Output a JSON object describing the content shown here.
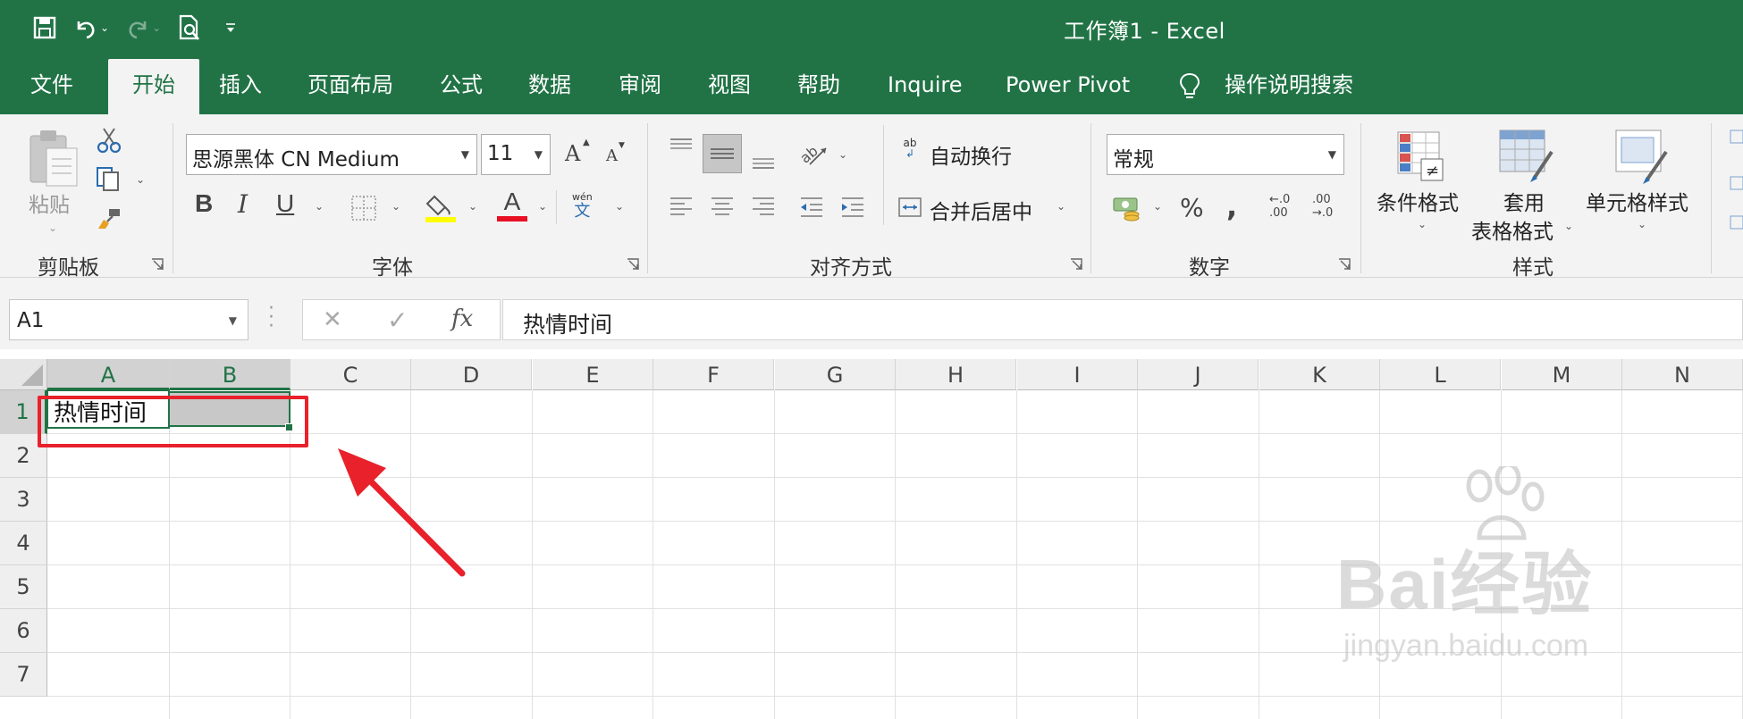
{
  "window": {
    "title": "工作簿1  -  Excel"
  },
  "qat": {
    "save_icon": "save-icon",
    "undo_icon": "undo-icon",
    "redo_icon": "redo-icon",
    "print_preview_icon": "print-preview-icon",
    "customize_icon": "customize-qat-icon"
  },
  "tabs": [
    {
      "label": "文件"
    },
    {
      "label": "开始"
    },
    {
      "label": "插入"
    },
    {
      "label": "页面布局"
    },
    {
      "label": "公式"
    },
    {
      "label": "数据"
    },
    {
      "label": "审阅"
    },
    {
      "label": "视图"
    },
    {
      "label": "帮助"
    },
    {
      "label": "Inquire"
    },
    {
      "label": "Power Pivot"
    }
  ],
  "active_tab": "开始",
  "tell_me": {
    "label": "操作说明搜索"
  },
  "ribbon": {
    "clipboard": {
      "label": "剪贴板",
      "paste": "粘贴"
    },
    "font": {
      "label": "字体",
      "font_name": "思源黑体 CN Medium",
      "font_size": "11",
      "bold": "B",
      "italic": "I",
      "underline": "U",
      "grow": "A",
      "shrink": "A",
      "font_color_glyph": "A",
      "phonetic_top": "wén",
      "phonetic_bottom": "文",
      "fill_color": "#FFFF00",
      "font_color": "#E81123"
    },
    "alignment": {
      "label": "对齐方式",
      "wrap_text": "自动换行",
      "merge_center": "合并后居中",
      "wrap_icon_text": "ab"
    },
    "number": {
      "label": "数字",
      "format": "常规",
      "percent": "%",
      "comma": ",",
      "inc_decimal_top": "←.0",
      "inc_decimal_bottom": ".00",
      "dec_decimal_top": ".00",
      "dec_decimal_bottom": "→.0"
    },
    "styles": {
      "label": "样式",
      "conditional": "条件格式",
      "as_table_line1": "套用",
      "as_table_line2": "表格格式",
      "cell_styles": "单元格样式"
    }
  },
  "formula_bar": {
    "name_box": "A1",
    "cancel": "✕",
    "enter": "✓",
    "fx": "fx",
    "value": "热情时间"
  },
  "sheet": {
    "columns": [
      "A",
      "B",
      "C",
      "D",
      "E",
      "F",
      "G",
      "H",
      "I",
      "J",
      "K",
      "L",
      "M",
      "N"
    ],
    "rows": [
      "1",
      "2",
      "3",
      "4",
      "5",
      "6",
      "7"
    ],
    "selected_cell": "A1",
    "cells": {
      "A1": "热情时间"
    }
  },
  "annotation": {
    "highlight_color": "#E8212B",
    "arrow_color": "#E8212B"
  },
  "watermark": {
    "brand": "Bai经验",
    "url": "jingyan.baidu.com"
  }
}
